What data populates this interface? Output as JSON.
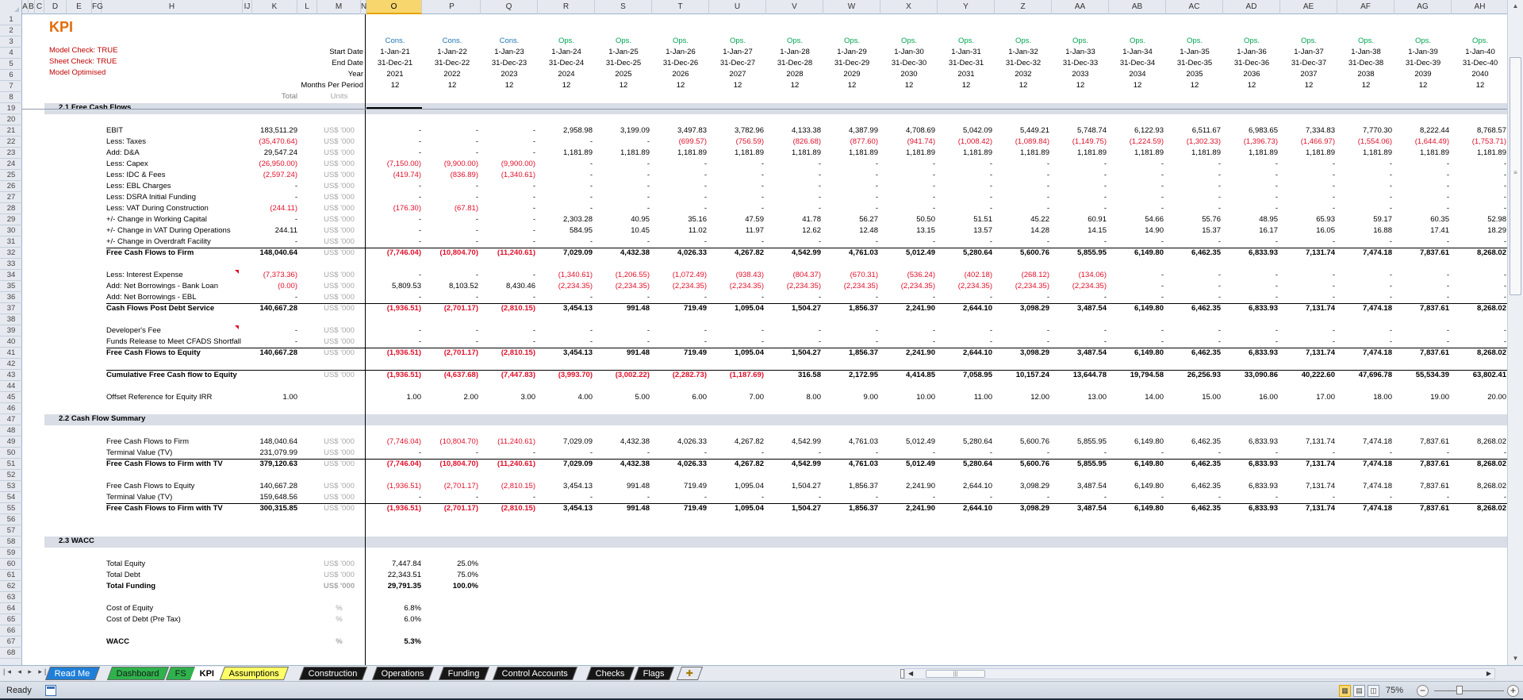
{
  "sheet": {
    "title": "KPI",
    "checks": [
      "Model Check: TRUE",
      "Sheet Check: TRUE",
      "Model Optimised"
    ],
    "column_letters": [
      "A",
      "B",
      "C",
      "D",
      "E",
      "FG",
      "H",
      "IJ",
      "K",
      "L",
      "M",
      "N",
      "O",
      "P",
      "Q",
      "R",
      "S",
      "T",
      "U",
      "V",
      "W",
      "X",
      "Y",
      "Z",
      "AA",
      "AB",
      "AC",
      "AD",
      "AE",
      "AF",
      "AG",
      "AH"
    ],
    "selected_column": "O",
    "row_numbers": [
      "1",
      "2",
      "3",
      "4",
      "5",
      "6",
      "7",
      "8",
      "19",
      "20",
      "21",
      "22",
      "23",
      "24",
      "25",
      "26",
      "27",
      "28",
      "29",
      "30",
      "31",
      "32",
      "33",
      "34",
      "35",
      "36",
      "37",
      "38",
      "39",
      "40",
      "41",
      "42",
      "43",
      "44",
      "45",
      "46",
      "47",
      "48",
      "49",
      "50",
      "51",
      "52",
      "53",
      "54",
      "55",
      "56",
      "57",
      "58",
      "59",
      "60",
      "61",
      "62",
      "63",
      "64",
      "65",
      "66",
      "67",
      "68"
    ]
  },
  "header": {
    "labels": {
      "start_date": "Start Date",
      "end_date": "End Date",
      "year": "Year",
      "months": "Months Per Period",
      "total": "Total",
      "units": "Units"
    },
    "periods": [
      {
        "phase": "Cons.",
        "start": "1-Jan-21",
        "end": "31-Dec-21",
        "year": "2021",
        "months": "12"
      },
      {
        "phase": "Cons.",
        "start": "1-Jan-22",
        "end": "31-Dec-22",
        "year": "2022",
        "months": "12"
      },
      {
        "phase": "Cons.",
        "start": "1-Jan-23",
        "end": "31-Dec-23",
        "year": "2023",
        "months": "12"
      },
      {
        "phase": "Ops.",
        "start": "1-Jan-24",
        "end": "31-Dec-24",
        "year": "2024",
        "months": "12"
      },
      {
        "phase": "Ops.",
        "start": "1-Jan-25",
        "end": "31-Dec-25",
        "year": "2025",
        "months": "12"
      },
      {
        "phase": "Ops.",
        "start": "1-Jan-26",
        "end": "31-Dec-26",
        "year": "2026",
        "months": "12"
      },
      {
        "phase": "Ops.",
        "start": "1-Jan-27",
        "end": "31-Dec-27",
        "year": "2027",
        "months": "12"
      },
      {
        "phase": "Ops.",
        "start": "1-Jan-28",
        "end": "31-Dec-28",
        "year": "2028",
        "months": "12"
      },
      {
        "phase": "Ops.",
        "start": "1-Jan-29",
        "end": "31-Dec-29",
        "year": "2029",
        "months": "12"
      },
      {
        "phase": "Ops.",
        "start": "1-Jan-30",
        "end": "31-Dec-30",
        "year": "2030",
        "months": "12"
      },
      {
        "phase": "Ops.",
        "start": "1-Jan-31",
        "end": "31-Dec-31",
        "year": "2031",
        "months": "12"
      },
      {
        "phase": "Ops.",
        "start": "1-Jan-32",
        "end": "31-Dec-32",
        "year": "2032",
        "months": "12"
      },
      {
        "phase": "Ops.",
        "start": "1-Jan-33",
        "end": "31-Dec-33",
        "year": "2033",
        "months": "12"
      },
      {
        "phase": "Ops.",
        "start": "1-Jan-34",
        "end": "31-Dec-34",
        "year": "2034",
        "months": "12"
      },
      {
        "phase": "Ops.",
        "start": "1-Jan-35",
        "end": "31-Dec-35",
        "year": "2035",
        "months": "12"
      },
      {
        "phase": "Ops.",
        "start": "1-Jan-36",
        "end": "31-Dec-36",
        "year": "2036",
        "months": "12"
      },
      {
        "phase": "Ops.",
        "start": "1-Jan-37",
        "end": "31-Dec-37",
        "year": "2037",
        "months": "12"
      },
      {
        "phase": "Ops.",
        "start": "1-Jan-38",
        "end": "31-Dec-38",
        "year": "2038",
        "months": "12"
      },
      {
        "phase": "Ops.",
        "start": "1-Jan-39",
        "end": "31-Dec-39",
        "year": "2039",
        "months": "12"
      },
      {
        "phase": "Ops.",
        "start": "1-Jan-40",
        "end": "31-Dec-40",
        "year": "2040",
        "months": "12"
      }
    ]
  },
  "sections": [
    {
      "row": "19",
      "title": "2.1  Free Cash Flows"
    },
    {
      "row": "47",
      "title": "2.2  Cash Flow Summary"
    },
    {
      "row": "58",
      "title": "2.3  WACC"
    }
  ],
  "rows": [
    {
      "row": "21",
      "label": "EBIT",
      "total": "183,511.29",
      "units": "US$ '000",
      "values": [
        "-",
        "-",
        "-",
        "2,958.98",
        "3,199.09",
        "3,497.83",
        "3,782.96",
        "4,133.38",
        "4,387.99",
        "4,708.69",
        "5,042.09",
        "5,449.21",
        "5,748.74",
        "6,122.93",
        "6,511.67",
        "6,983.65",
        "7,334.83",
        "7,770.30",
        "8,222.44",
        "8,768.57"
      ]
    },
    {
      "row": "22",
      "label": "Less: Taxes",
      "total": "(35,470.64)",
      "units": "US$ '000",
      "values": [
        "-",
        "-",
        "-",
        "-",
        "-",
        "(699.57)",
        "(756.59)",
        "(826.68)",
        "(877.60)",
        "(941.74)",
        "(1,008.42)",
        "(1,089.84)",
        "(1,149.75)",
        "(1,224.59)",
        "(1,302.33)",
        "(1,396.73)",
        "(1,466.97)",
        "(1,554.06)",
        "(1,644.49)",
        "(1,753.71)"
      ]
    },
    {
      "row": "23",
      "label": "Add: D&A",
      "total": "29,547.24",
      "units": "US$ '000",
      "values": [
        "-",
        "-",
        "-",
        "1,181.89",
        "1,181.89",
        "1,181.89",
        "1,181.89",
        "1,181.89",
        "1,181.89",
        "1,181.89",
        "1,181.89",
        "1,181.89",
        "1,181.89",
        "1,181.89",
        "1,181.89",
        "1,181.89",
        "1,181.89",
        "1,181.89",
        "1,181.89",
        "1,181.89"
      ]
    },
    {
      "row": "24",
      "label": "Less: Capex",
      "total": "(26,950.00)",
      "units": "US$ '000",
      "values": [
        "(7,150.00)",
        "(9,900.00)",
        "(9,900.00)",
        "-",
        "-",
        "-",
        "-",
        "-",
        "-",
        "-",
        "-",
        "-",
        "-",
        "-",
        "-",
        "-",
        "-",
        "-",
        "-",
        "-"
      ]
    },
    {
      "row": "25",
      "label": "Less: IDC & Fees",
      "total": "(2,597.24)",
      "units": "US$ '000",
      "values": [
        "(419.74)",
        "(836.89)",
        "(1,340.61)",
        "-",
        "-",
        "-",
        "-",
        "-",
        "-",
        "-",
        "-",
        "-",
        "-",
        "-",
        "-",
        "-",
        "-",
        "-",
        "-",
        "-"
      ]
    },
    {
      "row": "26",
      "label": "Less: EBL Charges",
      "total": "-",
      "units": "US$ '000",
      "values": [
        "-",
        "-",
        "-",
        "-",
        "-",
        "-",
        "-",
        "-",
        "-",
        "-",
        "-",
        "-",
        "-",
        "-",
        "-",
        "-",
        "-",
        "-",
        "-",
        "-"
      ]
    },
    {
      "row": "27",
      "label": "Less: DSRA Initial Funding",
      "total": "-",
      "units": "US$ '000",
      "values": [
        "-",
        "-",
        "-",
        "-",
        "-",
        "-",
        "-",
        "-",
        "-",
        "-",
        "-",
        "-",
        "-",
        "-",
        "-",
        "-",
        "-",
        "-",
        "-",
        "-"
      ]
    },
    {
      "row": "28",
      "label": "Less: VAT During Construction",
      "total": "(244.11)",
      "units": "US$ '000",
      "values": [
        "(176.30)",
        "(67.81)",
        "-",
        "-",
        "-",
        "-",
        "-",
        "-",
        "-",
        "-",
        "-",
        "-",
        "-",
        "-",
        "-",
        "-",
        "-",
        "-",
        "-",
        "-"
      ]
    },
    {
      "row": "29",
      "label": "+/- Change in Working Capital",
      "total": "-",
      "units": "US$ '000",
      "values": [
        "-",
        "-",
        "-",
        "2,303.28",
        "40.95",
        "35.16",
        "47.59",
        "41.78",
        "56.27",
        "50.50",
        "51.51",
        "45.22",
        "60.91",
        "54.66",
        "55.76",
        "48.95",
        "65.93",
        "59.17",
        "60.35",
        "52.98"
      ]
    },
    {
      "row": "30",
      "label": "+/- Change in VAT During Operations",
      "total": "244.11",
      "units": "US$ '000",
      "values": [
        "-",
        "-",
        "-",
        "584.95",
        "10.45",
        "11.02",
        "11.97",
        "12.62",
        "12.48",
        "13.15",
        "13.57",
        "14.28",
        "14.15",
        "14.90",
        "15.37",
        "16.17",
        "16.05",
        "16.88",
        "17.41",
        "18.29"
      ]
    },
    {
      "row": "31",
      "label": "+/- Change in Overdraft Facility",
      "total": "-",
      "units": "US$ '000",
      "values": [
        "-",
        "-",
        "-",
        "-",
        "-",
        "-",
        "-",
        "-",
        "-",
        "-",
        "-",
        "-",
        "-",
        "-",
        "-",
        "-",
        "-",
        "-",
        "-",
        "-"
      ]
    },
    {
      "row": "32",
      "label": "Free Cash Flows to Firm",
      "total": "148,040.64",
      "units": "US$ '000",
      "bold": true,
      "topline": true,
      "values": [
        "(7,746.04)",
        "(10,804.70)",
        "(11,240.61)",
        "7,029.09",
        "4,432.38",
        "4,026.33",
        "4,267.82",
        "4,542.99",
        "4,761.03",
        "5,012.49",
        "5,280.64",
        "5,600.76",
        "5,855.95",
        "6,149.80",
        "6,462.35",
        "6,833.93",
        "7,131.74",
        "7,474.18",
        "7,837.61",
        "8,268.02"
      ]
    },
    {
      "row": "34",
      "label": "Less: Interest Expense",
      "total": "(7,373.36)",
      "units": "US$ '000",
      "comment": true,
      "values": [
        "-",
        "-",
        "-",
        "(1,340.61)",
        "(1,206.55)",
        "(1,072.49)",
        "(938.43)",
        "(804.37)",
        "(670.31)",
        "(536.24)",
        "(402.18)",
        "(268.12)",
        "(134.06)",
        "-",
        "-",
        "-",
        "-",
        "-",
        "-",
        "-"
      ]
    },
    {
      "row": "35",
      "label": "Add: Net Borrowings - Bank Loan",
      "total": "(0.00)",
      "units": "US$ '000",
      "values": [
        "5,809.53",
        "8,103.52",
        "8,430.46",
        "(2,234.35)",
        "(2,234.35)",
        "(2,234.35)",
        "(2,234.35)",
        "(2,234.35)",
        "(2,234.35)",
        "(2,234.35)",
        "(2,234.35)",
        "(2,234.35)",
        "(2,234.35)",
        "-",
        "-",
        "-",
        "-",
        "-",
        "-",
        "-"
      ]
    },
    {
      "row": "36",
      "label": "Add: Net Borrowings - EBL",
      "total": "-",
      "units": "US$ '000",
      "values": [
        "-",
        "-",
        "-",
        "-",
        "-",
        "-",
        "-",
        "-",
        "-",
        "-",
        "-",
        "-",
        "-",
        "-",
        "-",
        "-",
        "-",
        "-",
        "-",
        "-"
      ]
    },
    {
      "row": "37",
      "label": "Cash Flows Post Debt Service",
      "total": "140,667.28",
      "units": "US$ '000",
      "bold": true,
      "topline": true,
      "values": [
        "(1,936.51)",
        "(2,701.17)",
        "(2,810.15)",
        "3,454.13",
        "991.48",
        "719.49",
        "1,095.04",
        "1,504.27",
        "1,856.37",
        "2,241.90",
        "2,644.10",
        "3,098.29",
        "3,487.54",
        "6,149.80",
        "6,462.35",
        "6,833.93",
        "7,131.74",
        "7,474.18",
        "7,837.61",
        "8,268.02"
      ]
    },
    {
      "row": "39",
      "label": "Developer's Fee",
      "total": "-",
      "units": "US$ '000",
      "comment": true,
      "values": [
        "-",
        "-",
        "-",
        "-",
        "-",
        "-",
        "-",
        "-",
        "-",
        "-",
        "-",
        "-",
        "-",
        "-",
        "-",
        "-",
        "-",
        "-",
        "-",
        "-"
      ]
    },
    {
      "row": "40",
      "label": "Funds Release to Meet CFADS Shortfall",
      "total": "-",
      "units": "US$ '000",
      "values": [
        "-",
        "-",
        "-",
        "-",
        "-",
        "-",
        "-",
        "-",
        "-",
        "-",
        "-",
        "-",
        "-",
        "-",
        "-",
        "-",
        "-",
        "-",
        "-",
        "-"
      ]
    },
    {
      "row": "41",
      "label": "Free Cash Flows to Equity",
      "total": "140,667.28",
      "units": "US$ '000",
      "bold": true,
      "topline": true,
      "values": [
        "(1,936.51)",
        "(2,701.17)",
        "(2,810.15)",
        "3,454.13",
        "991.48",
        "719.49",
        "1,095.04",
        "1,504.27",
        "1,856.37",
        "2,241.90",
        "2,644.10",
        "3,098.29",
        "3,487.54",
        "6,149.80",
        "6,462.35",
        "6,833.93",
        "7,131.74",
        "7,474.18",
        "7,837.61",
        "8,268.02"
      ]
    },
    {
      "row": "43",
      "label": "Cumulative Free Cash flow to Equity",
      "total": "",
      "units": "US$ '000",
      "bold": true,
      "topline": true,
      "values": [
        "(1,936.51)",
        "(4,637.68)",
        "(7,447.83)",
        "(3,993.70)",
        "(3,002.22)",
        "(2,282.73)",
        "(1,187.69)",
        "316.58",
        "2,172.95",
        "4,414.85",
        "7,058.95",
        "10,157.24",
        "13,644.78",
        "19,794.58",
        "26,256.93",
        "33,090.86",
        "40,222.60",
        "47,696.78",
        "55,534.39",
        "63,802.41"
      ]
    },
    {
      "row": "45",
      "label": "Offset Reference for Equity IRR",
      "total": "1.00",
      "units": "",
      "values": [
        "1.00",
        "2.00",
        "3.00",
        "4.00",
        "5.00",
        "6.00",
        "7.00",
        "8.00",
        "9.00",
        "10.00",
        "11.00",
        "12.00",
        "13.00",
        "14.00",
        "15.00",
        "16.00",
        "17.00",
        "18.00",
        "19.00",
        "20.00"
      ]
    },
    {
      "row": "49",
      "label": "Free Cash Flows to Firm",
      "total": "148,040.64",
      "units": "US$ '000",
      "values": [
        "(7,746.04)",
        "(10,804.70)",
        "(11,240.61)",
        "7,029.09",
        "4,432.38",
        "4,026.33",
        "4,267.82",
        "4,542.99",
        "4,761.03",
        "5,012.49",
        "5,280.64",
        "5,600.76",
        "5,855.95",
        "6,149.80",
        "6,462.35",
        "6,833.93",
        "7,131.74",
        "7,474.18",
        "7,837.61",
        "8,268.02"
      ]
    },
    {
      "row": "50",
      "label": "Terminal Value (TV)",
      "total": "231,079.99",
      "units": "US$ '000",
      "values": [
        "-",
        "-",
        "-",
        "-",
        "-",
        "-",
        "-",
        "-",
        "-",
        "-",
        "-",
        "-",
        "-",
        "-",
        "-",
        "-",
        "-",
        "-",
        "-",
        "-"
      ]
    },
    {
      "row": "51",
      "label": "Free Cash Flows to Firm with TV",
      "total": "379,120.63",
      "units": "US$ '000",
      "bold": true,
      "topline": true,
      "values": [
        "(7,746.04)",
        "(10,804.70)",
        "(11,240.61)",
        "7,029.09",
        "4,432.38",
        "4,026.33",
        "4,267.82",
        "4,542.99",
        "4,761.03",
        "5,012.49",
        "5,280.64",
        "5,600.76",
        "5,855.95",
        "6,149.80",
        "6,462.35",
        "6,833.93",
        "7,131.74",
        "7,474.18",
        "7,837.61",
        "8,268.02"
      ]
    },
    {
      "row": "53",
      "label": "Free Cash Flows to Equity",
      "total": "140,667.28",
      "units": "US$ '000",
      "values": [
        "(1,936.51)",
        "(2,701.17)",
        "(2,810.15)",
        "3,454.13",
        "991.48",
        "719.49",
        "1,095.04",
        "1,504.27",
        "1,856.37",
        "2,241.90",
        "2,644.10",
        "3,098.29",
        "3,487.54",
        "6,149.80",
        "6,462.35",
        "6,833.93",
        "7,131.74",
        "7,474.18",
        "7,837.61",
        "8,268.02"
      ]
    },
    {
      "row": "54",
      "label": "Terminal Value (TV)",
      "total": "159,648.56",
      "units": "US$ '000",
      "values": [
        "-",
        "-",
        "-",
        "-",
        "-",
        "-",
        "-",
        "-",
        "-",
        "-",
        "-",
        "-",
        "-",
        "-",
        "-",
        "-",
        "-",
        "-",
        "-",
        "-"
      ]
    },
    {
      "row": "55",
      "label": "Free Cash Flows to Firm with TV",
      "total": "300,315.85",
      "units": "US$ '000",
      "bold": true,
      "topline": true,
      "values": [
        "(1,936.51)",
        "(2,701.17)",
        "(2,810.15)",
        "3,454.13",
        "991.48",
        "719.49",
        "1,095.04",
        "1,504.27",
        "1,856.37",
        "2,241.90",
        "2,644.10",
        "3,098.29",
        "3,487.54",
        "6,149.80",
        "6,462.35",
        "6,833.93",
        "7,131.74",
        "7,474.18",
        "7,837.61",
        "8,268.02"
      ]
    }
  ],
  "wacc": [
    {
      "row": "60",
      "label": "Total Equity",
      "units": "US$ '000",
      "value": "7,447.84",
      "share": "25.0%"
    },
    {
      "row": "61",
      "label": "Total Debt",
      "units": "US$ '000",
      "value": "22,343.51",
      "share": "75.0%"
    },
    {
      "row": "62",
      "label": "Total Funding",
      "units": "US$ '000",
      "value": "29,791.35",
      "share": "100.0%",
      "bold": true
    },
    {
      "row": "64",
      "label": "Cost of Equity",
      "units": "%",
      "value": "6.8%",
      "share": ""
    },
    {
      "row": "65",
      "label": "Cost of Debt (Pre Tax)",
      "units": "%",
      "value": "6.0%",
      "share": ""
    },
    {
      "row": "67",
      "label": "WACC",
      "units": "%",
      "value": "5.3%",
      "share": "",
      "bold": true
    }
  ],
  "tabs": [
    {
      "label": "Read Me",
      "color": "blue"
    },
    {
      "label": "Dashboard",
      "color": "green"
    },
    {
      "label": "FS",
      "color": "green"
    },
    {
      "label": "KPI",
      "color": "active"
    },
    {
      "label": "Assumptions",
      "color": "yellow"
    },
    {
      "label": "Construction",
      "color": "black"
    },
    {
      "label": "Operations",
      "color": "black"
    },
    {
      "label": "Funding",
      "color": "black"
    },
    {
      "label": "Control Accounts",
      "color": "black"
    },
    {
      "label": "Checks",
      "color": "black"
    },
    {
      "label": "Flags",
      "color": "black"
    }
  ],
  "status": {
    "text": "Ready",
    "zoom": "75%",
    "zoom_level_percent": 75
  },
  "colors": {
    "title": "#e36c09",
    "check_text": "#c00000",
    "negative": "#e0102a",
    "cons_phase": "#1f77b4",
    "ops_phase": "#00a651",
    "section_band": "#d9dde5"
  }
}
